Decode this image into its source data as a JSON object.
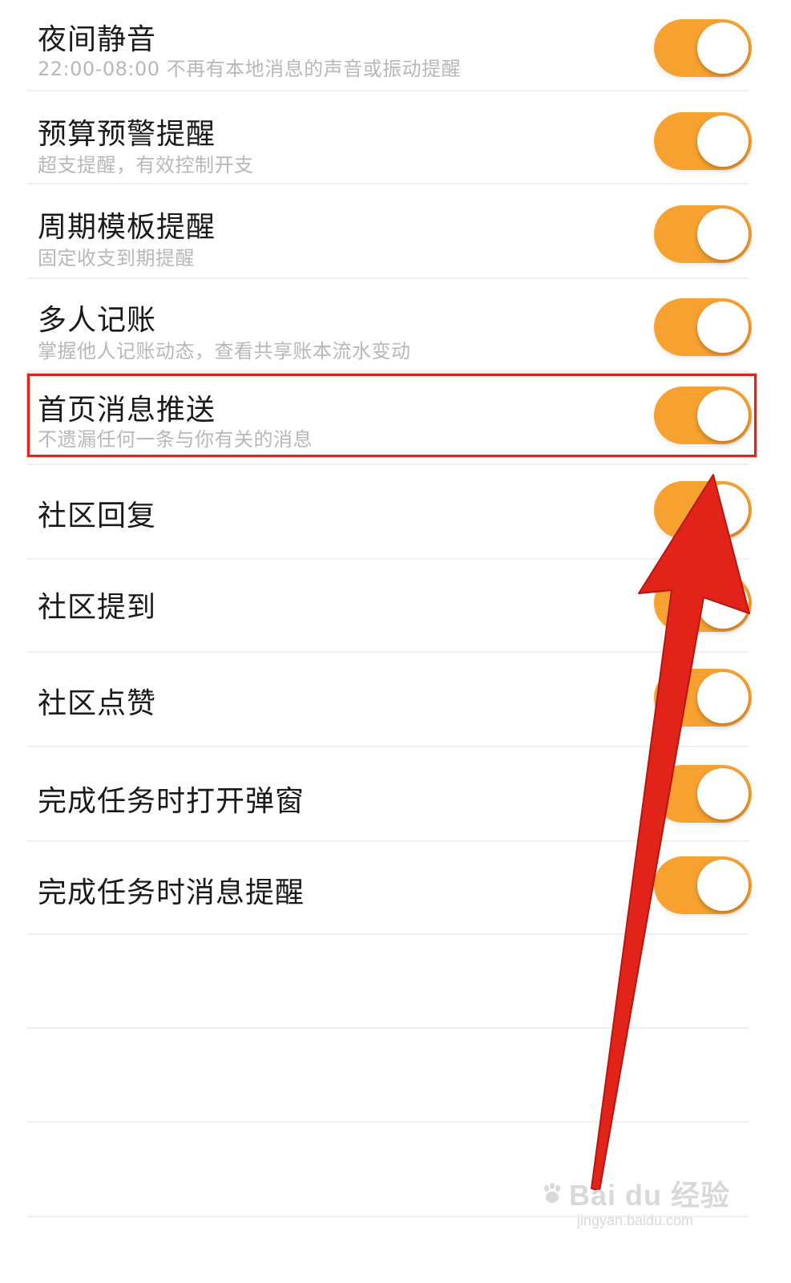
{
  "settings": [
    {
      "title": "夜间静音",
      "subtitle": "22:00-08:00 不再有本地消息的声音或振动提醒",
      "on": true
    },
    {
      "title": "预算预警提醒",
      "subtitle": "超支提醒，有效控制开支",
      "on": true
    },
    {
      "title": "周期模板提醒",
      "subtitle": "固定收支到期提醒",
      "on": true
    },
    {
      "title": "多人记账",
      "subtitle": "掌握他人记账动态，查看共享账本流水变动",
      "on": true
    },
    {
      "title": "首页消息推送",
      "subtitle": "不遗漏任何一条与你有关的消息",
      "on": true
    },
    {
      "title": "社区回复",
      "subtitle": "",
      "on": true
    },
    {
      "title": "社区提到",
      "subtitle": "",
      "on": true
    },
    {
      "title": "社区点赞",
      "subtitle": "",
      "on": true
    },
    {
      "title": "完成任务时打开弹窗",
      "subtitle": "",
      "on": true
    },
    {
      "title": "完成任务时消息提醒",
      "subtitle": "",
      "on": true
    }
  ],
  "colors": {
    "toggle_on": "#f7a130",
    "annotation_red": "#e2231a",
    "subtitle_gray": "#b8b8b8"
  },
  "watermark": {
    "main": "Bai du 经验",
    "url": "jingyan.baidu.com"
  }
}
